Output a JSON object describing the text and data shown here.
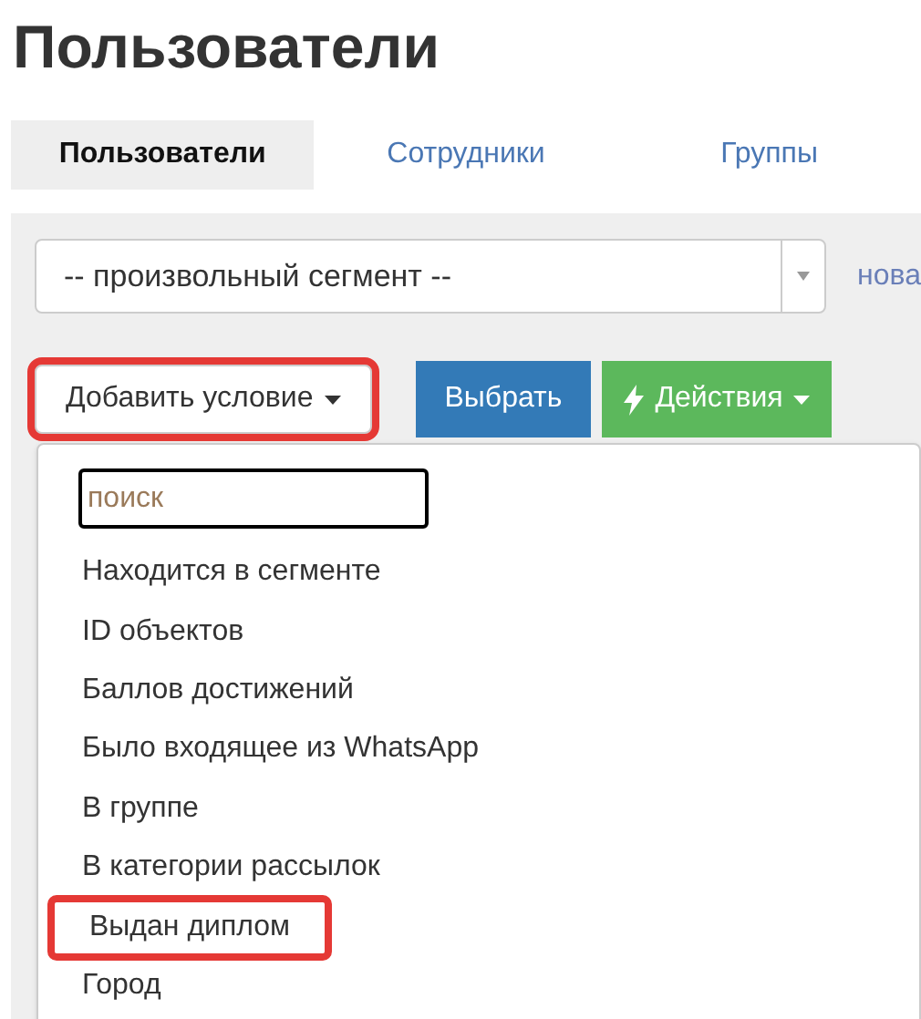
{
  "page_title": "Пользователи",
  "tabs": [
    {
      "label": "Пользователи",
      "selected": true
    },
    {
      "label": "Сотрудники",
      "selected": false
    },
    {
      "label": "Группы",
      "selected": false
    }
  ],
  "segment_select": {
    "value": "-- произвольный сегмент --"
  },
  "new_link": "нова",
  "toolbar": [
    {
      "kind": "dropdown",
      "label": "Добавить условие",
      "highlighted": true
    },
    {
      "kind": "primary",
      "label": "Выбрать",
      "highlighted": false
    },
    {
      "kind": "actions",
      "label": "Действия",
      "highlighted": false
    }
  ],
  "condition_menu": {
    "search": {
      "placeholder": "поиск"
    },
    "items": [
      {
        "label": "Находится в сегменте",
        "highlighted": false
      },
      {
        "label": "ID объектов",
        "highlighted": false
      },
      {
        "label": "Баллов достижений",
        "highlighted": false
      },
      {
        "label": "Было входящее из WhatsApp",
        "highlighted": false
      },
      {
        "label": "В группе",
        "highlighted": false
      },
      {
        "label": "В категории рассылок",
        "highlighted": false
      },
      {
        "label": "Выдан диплом",
        "highlighted": true
      },
      {
        "label": "Город",
        "highlighted": false
      }
    ]
  }
}
